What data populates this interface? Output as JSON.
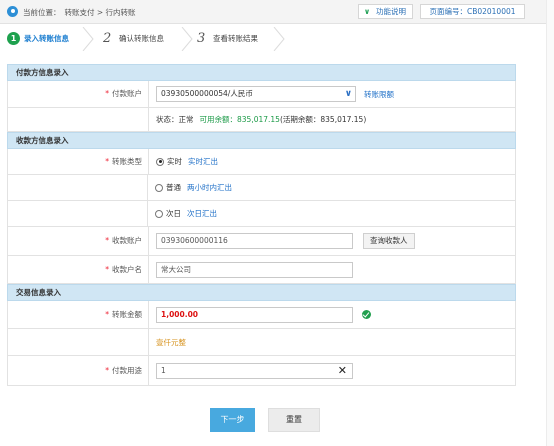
{
  "topbar": {
    "location_prefix": "当前位置：",
    "location_path": "转账支付 > 行内转账",
    "function_help": "功能说明",
    "page_number": "页面编号：CB02010001"
  },
  "steps": [
    {
      "num": "1",
      "label": "录入转账信息"
    },
    {
      "num": "2",
      "label": "确认转账信息"
    },
    {
      "num": "3",
      "label": "查看转账结果"
    }
  ],
  "payer": {
    "section_title": "付款方信息录入",
    "account_label": "付款账户",
    "account_value": "03930500000054/人民币",
    "limit_link": "转账限额",
    "status_text": "状态：正常",
    "available_text": "可用余额：835,017.15",
    "current_text": "(活期余额：835,017.15)"
  },
  "payee": {
    "section_title": "收款方信息录入",
    "type_label": "转账类型",
    "options": [
      {
        "label": "实时",
        "desc": "实时汇出",
        "selected": true
      },
      {
        "label": "普通",
        "desc": "两小时内汇出",
        "selected": false
      },
      {
        "label": "次日",
        "desc": "次日汇出",
        "selected": false
      }
    ],
    "account_label": "收款账户",
    "account_value": "03930600000116",
    "query_button": "查询收款人",
    "name_label": "收款户名",
    "name_value": "常大公司"
  },
  "transaction": {
    "section_title": "交易信息录入",
    "amount_label": "转账金额",
    "amount_value": "1,000.00",
    "amount_upper": "壹仟元整",
    "purpose_label": "付款用途",
    "purpose_value": "1"
  },
  "buttons": {
    "next": "下一步",
    "reset": "重置"
  },
  "colors": {
    "accent_blue": "#48a9df",
    "step_green": "#1ea14e",
    "section_bg": "#d0e6f4",
    "amount_red": "#dd1111"
  }
}
